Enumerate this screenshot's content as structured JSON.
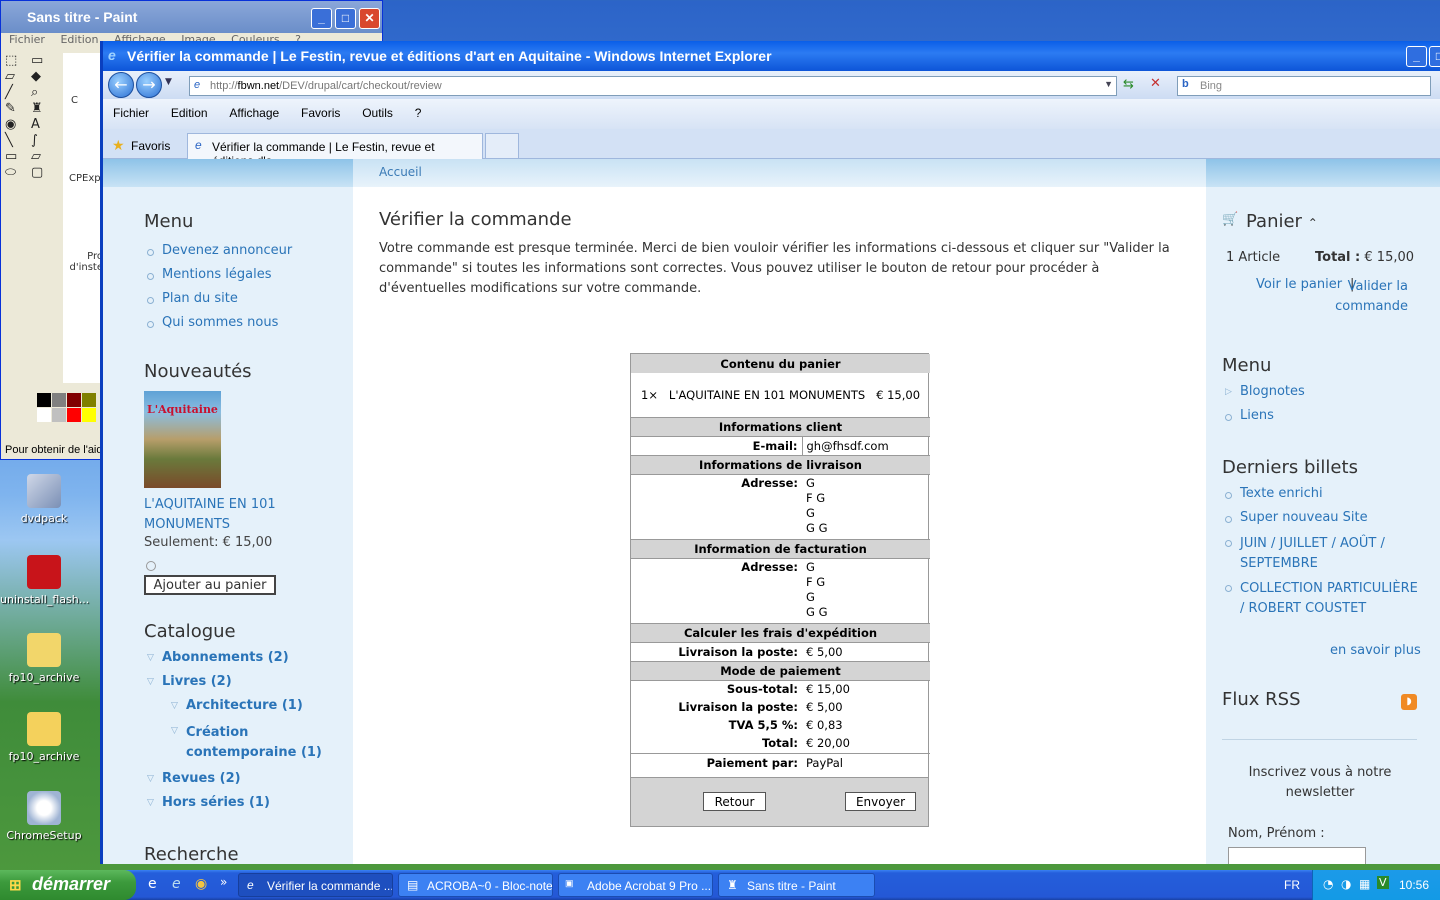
{
  "desktop": {
    "icons": [
      {
        "label": "dvdpack"
      },
      {
        "label": "uninstall_flash..."
      },
      {
        "label": "fp10_archive"
      },
      {
        "label": "fp10_archive"
      },
      {
        "label": "ChromeSetup"
      }
    ]
  },
  "paint": {
    "title": "Sans titre - Paint",
    "menu": [
      "Fichier",
      "Edition",
      "Affichage",
      "Image",
      "Couleurs",
      "?"
    ],
    "status": "Pour obtenir de l'aide",
    "canvas_labels": [
      "CPExp",
      "Pro d'inste",
      "C"
    ]
  },
  "ie": {
    "title": "Vérifier la commande | Le Festin, revue et éditions d'art en Aquitaine - Windows Internet Explorer",
    "address_prefix": "http://",
    "address_host": "fbwn.net",
    "address_path": "/DEV/drupal/cart/checkout/review",
    "search_placeholder": "Bing",
    "menu": [
      "Fichier",
      "Edition",
      "Affichage",
      "Favoris",
      "Outils",
      "?"
    ],
    "favorites_label": "Favoris",
    "tab_label": "Vérifier la commande | Le Festin, revue et éditions d'a..."
  },
  "page": {
    "breadcrumb": "Accueil",
    "left": {
      "menu_title": "Menu",
      "menu_items": [
        "Devenez annonceur",
        "Mentions légales",
        "Plan du site",
        "Qui sommes nous"
      ],
      "news_title": "Nouveautés",
      "cover_title": "L'Aquitaine",
      "product_name": "L'AQUITAINE EN 101 MONUMENTS",
      "price_line": "Seulement: € 15,00",
      "add_to_cart": "Ajouter au panier",
      "catalog_title": "Catalogue",
      "catalog": [
        {
          "label": "Abonnements (2)"
        },
        {
          "label": "Livres (2)"
        },
        {
          "label": "Architecture (1)"
        },
        {
          "label": "Création contemporaine (1)"
        },
        {
          "label": "Revues (2)"
        },
        {
          "label": "Hors séries (1)"
        }
      ],
      "search_title": "Recherche"
    },
    "main": {
      "title": "Vérifier la commande",
      "intro": "Votre commande est presque terminée. Merci de bien vouloir vérifier les informations ci-dessous et cliquer sur \"Valider la commande\" si toutes les informations sont correctes. Vous pouvez utiliser le bouton de retour pour procéder à d'éventuelles modifications sur votre commande.",
      "cart_header": "Contenu du panier",
      "cart_qty": "1×",
      "cart_item": "L'AQUITAINE EN 101 MONUMENTS",
      "cart_price": "€ 15,00",
      "client_header": "Informations client",
      "email_label": "E-mail:",
      "email_value": "gh@fhsdf.com",
      "delivery_header": "Informations de livraison",
      "delivery_label": "Adresse:",
      "delivery_lines": [
        "G",
        "F G",
        "G",
        "G G"
      ],
      "billing_header": "Information de facturation",
      "billing_label": "Adresse:",
      "billing_lines": [
        "G",
        "F G",
        "G",
        "G G"
      ],
      "shipping_header": "Calculer les frais d'expédition",
      "shipping_label": "Livraison la poste:",
      "shipping_value": "€ 5,00",
      "payment_header": "Mode de paiement",
      "subtotal_label": "Sous-total:",
      "subtotal_value": "€ 15,00",
      "ship2_label": "Livraison la poste:",
      "ship2_value": "€ 5,00",
      "tva_label": "TVA 5,5 %:",
      "tva_value": "€ 0,83",
      "total_label": "Total:",
      "total_value": "€ 20,00",
      "payby_label": "Paiement par:",
      "payby_value": "PayPal",
      "back_button": "Retour",
      "submit_button": "Envoyer"
    },
    "right": {
      "cart_title": "Panier",
      "cart_count": "1 Article",
      "cart_total_label": "Total :",
      "cart_total_value": "€ 15,00",
      "view_cart": "Voir le panier",
      "separator": "|",
      "checkout": "Valider la commande",
      "menu_title": "Menu",
      "menu_items": [
        "Blognotes",
        "Liens"
      ],
      "posts_title": "Derniers billets",
      "posts": [
        "Texte enrichi",
        "Super nouveau Site",
        "JUIN / JUILLET / AOÛT / SEPTEMBRE",
        "COLLECTION PARTICULIÈRE / ROBERT COUSTET"
      ],
      "read_more": "en savoir plus",
      "rss_title": "Flux RSS",
      "newsletter_text": "Inscrivez vous à notre newsletter",
      "name_label": "Nom, Prénom :"
    }
  },
  "taskbar": {
    "start": "démarrer",
    "items": [
      "Vérifier la commande ...",
      "ACROBA~0 - Bloc-notes",
      "Adobe Acrobat 9 Pro ...",
      "Sans titre - Paint"
    ],
    "lang": "FR",
    "clock": "10:56"
  }
}
